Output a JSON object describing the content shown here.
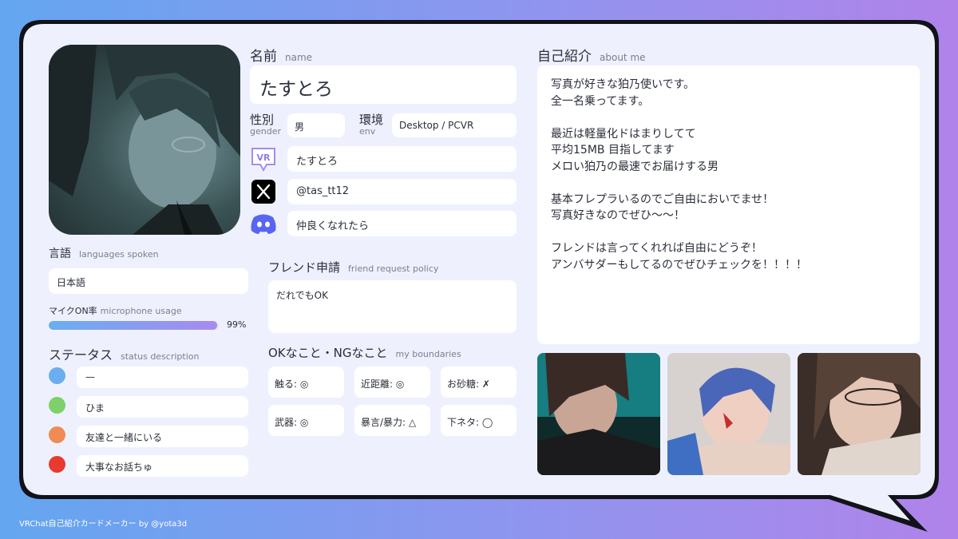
{
  "colors": {
    "accent_blue": "#6aaef0",
    "accent_purple": "#a78bf0",
    "status_blue": "#6aaef0",
    "status_green": "#7ed06a",
    "status_orange": "#f08b55",
    "status_red": "#e83a2e"
  },
  "name": {
    "label": "名前",
    "sub": "name",
    "value": "たすとろ"
  },
  "gender": {
    "label": "性別",
    "sub": "gender",
    "value": "男"
  },
  "env": {
    "label": "環境",
    "sub": "env",
    "value": "Desktop / PCVR"
  },
  "socials": [
    {
      "icon": "vrchat-icon",
      "value": "たすとろ"
    },
    {
      "icon": "x-icon",
      "value": "@tas_tt12"
    },
    {
      "icon": "discord-icon",
      "value": "仲良くなれたら"
    }
  ],
  "language": {
    "label": "言語",
    "sub": "languages spoken",
    "value": "日本語"
  },
  "mic": {
    "label": "マイクON率",
    "sub": "microphone usage",
    "percent_text": "99%",
    "percent": 99
  },
  "status": {
    "label": "ステータス",
    "sub": "status description",
    "items": [
      {
        "color": "#6aaef0",
        "text": "—"
      },
      {
        "color": "#7ed06a",
        "text": "ひま"
      },
      {
        "color": "#f08b55",
        "text": "友達と一緒にいる"
      },
      {
        "color": "#e83a2e",
        "text": "大事なお話ちゅ"
      }
    ]
  },
  "friend": {
    "label": "フレンド申請",
    "sub": "friend request policy",
    "value": "だれでもOK"
  },
  "boundaries": {
    "label": "OKなこと・NGなこと",
    "sub": "my boundaries",
    "items": [
      "触る: ◎",
      "近距離: ◎",
      "お砂糖: ✗",
      "武器: ◎",
      "暴言/暴力: △",
      "下ネタ: ◯"
    ]
  },
  "about": {
    "label": "自己紹介",
    "sub": "about me",
    "lines": [
      "写真が好きな狛乃使いです。",
      "全一名乗ってます。",
      "",
      "最近は軽量化ドはまりしてて",
      "平均15MB 目指してます",
      "メロい狛乃の最速でお届けする男",
      "",
      "基本フレプラいるのでご自由においでませ！",
      "写真好きなのでぜひ〜〜！",
      "",
      "フレンドは言ってくれれば自由にどうぞ！",
      "アンバサダーもしてるのでぜひチェックを！！！！"
    ]
  },
  "footer": "VRChat自己紹介カードメーカー by @yota3d"
}
